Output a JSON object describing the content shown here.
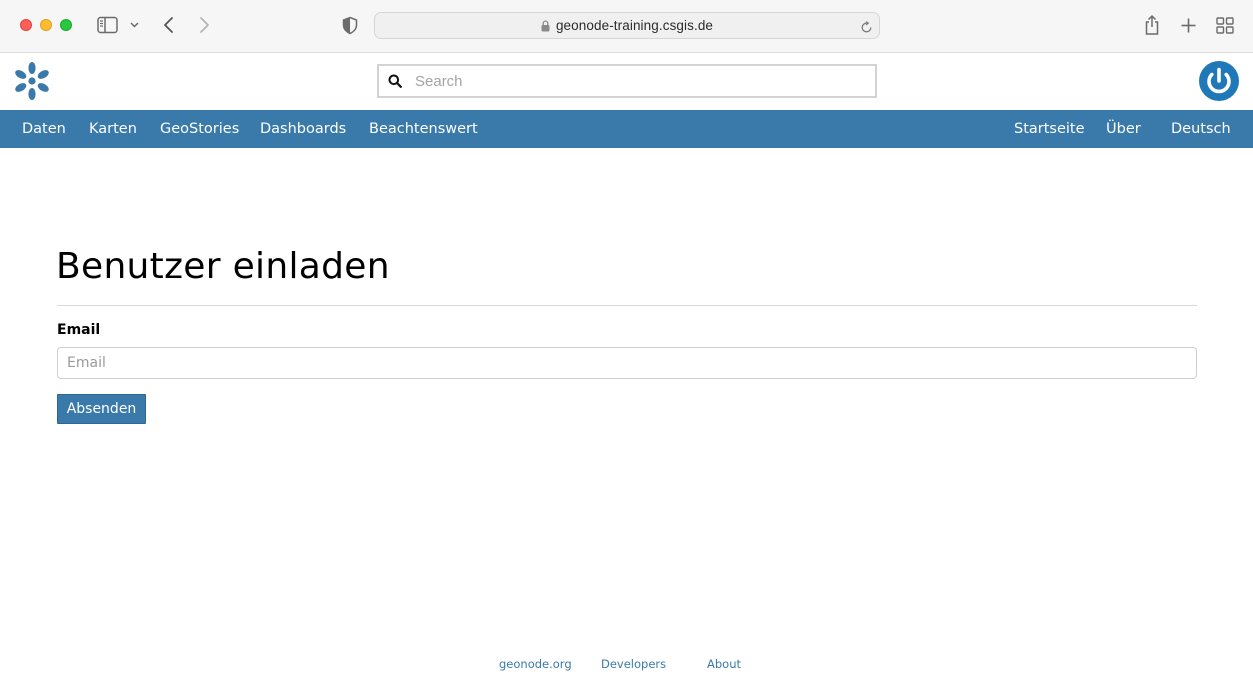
{
  "browser": {
    "url": "geonode-training.csgis.de"
  },
  "header": {
    "search_placeholder": "Search"
  },
  "nav": {
    "left_items": [
      {
        "label": "Daten"
      },
      {
        "label": "Karten"
      },
      {
        "label": "GeoStories"
      },
      {
        "label": "Dashboards"
      },
      {
        "label": "Beachtenswert"
      }
    ],
    "right_items": [
      {
        "label": "Startseite"
      },
      {
        "label": "Über"
      },
      {
        "label": "Deutsch"
      }
    ],
    "color": "#3a7aab"
  },
  "main": {
    "title": "Benutzer einladen",
    "email_label": "Email",
    "email_placeholder": "Email",
    "email_value": "",
    "submit_label": "Absenden"
  },
  "footer": {
    "links": [
      {
        "label": "geonode.org"
      },
      {
        "label": "Developers"
      },
      {
        "label": "About"
      }
    ]
  },
  "colors": {
    "brand": "#3a7aab",
    "close": "#ff5f57",
    "minimize": "#febc2e",
    "maximize": "#28c840"
  }
}
